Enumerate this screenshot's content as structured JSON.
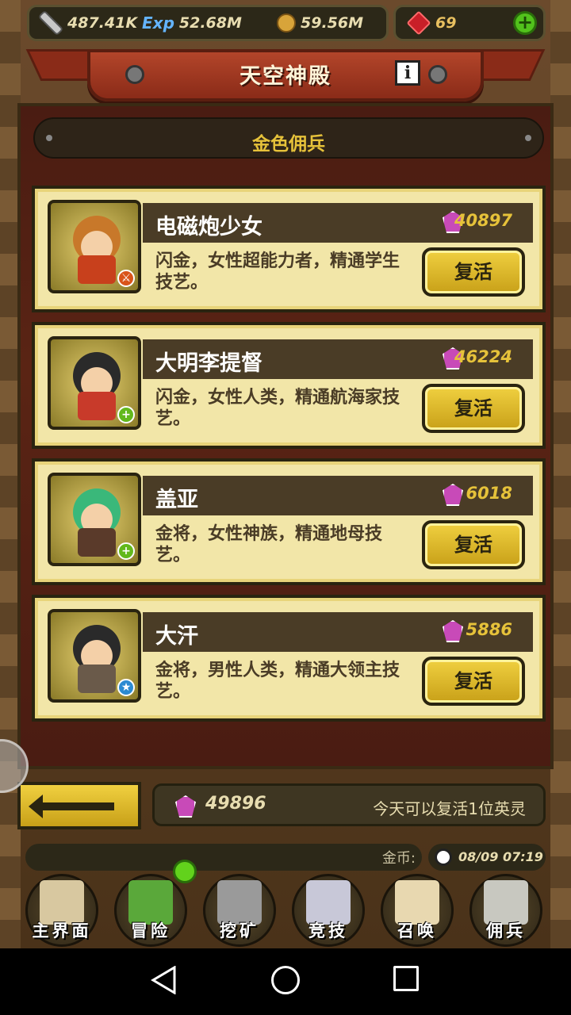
{
  "resources": {
    "attack": "487.41K",
    "exp": "52.68M",
    "gold": "59.56M",
    "gems": "69",
    "exp_icon_text": "Exp"
  },
  "header": {
    "title": "天空神殿",
    "info_icon": "i"
  },
  "subheader": "金色佣兵",
  "heroes": [
    {
      "name": "电磁炮少女",
      "cost": "40897",
      "desc": "闪金，女性超能力者，精通学生技艺。",
      "button": "复活",
      "badge_icon": "sword-badge-icon",
      "badge_color": "#d9541a",
      "hair": "#c8782a",
      "outfit": "#c8401c"
    },
    {
      "name": "大明李提督",
      "cost": "46224",
      "desc": "闪金，女性人类，精通航海家技艺。",
      "button": "复活",
      "badge_icon": "plus-badge-icon",
      "badge_color": "#62b81c",
      "hair": "#2a2a2a",
      "outfit": "#c83a2a"
    },
    {
      "name": "盖亚",
      "cost": "6018",
      "desc": "金将，女性神族，精通地母技艺。",
      "button": "复活",
      "badge_icon": "plus-badge-icon",
      "badge_color": "#62b81c",
      "hair": "#3ab87a",
      "outfit": "#5a3a2a"
    },
    {
      "name": "大汗",
      "cost": "5886",
      "desc": "金将，男性人类，精通大领主技艺。",
      "button": "复活",
      "badge_icon": "star-badge-icon",
      "badge_color": "#2a8ad2",
      "hair": "#2a2a2a",
      "outfit": "#6a5a4a"
    }
  ],
  "footer": {
    "gem_total": "49896",
    "revive_note": "今天可以复活1位英灵",
    "gold_label": "金币:",
    "clock": "08/09 07:19"
  },
  "nav": [
    {
      "label": "主界面",
      "icon": "scroll-map-icon",
      "color": "#d8c8a0"
    },
    {
      "label": "冒险",
      "icon": "island-icon",
      "color": "#5aa83a"
    },
    {
      "label": "挖矿",
      "icon": "pickaxe-icon",
      "color": "#9a9a9a"
    },
    {
      "label": "竞技",
      "icon": "crossed-swords-icon",
      "color": "#c8c8d8"
    },
    {
      "label": "召唤",
      "icon": "summon-scroll-icon",
      "color": "#e8d8b0"
    },
    {
      "label": "佣兵",
      "icon": "tent-icon",
      "color": "#c8c8c0"
    }
  ],
  "colors": {
    "accent_gold": "#e6c23a",
    "panel_red": "#5a2414",
    "card_bg": "#f2e6a8"
  }
}
